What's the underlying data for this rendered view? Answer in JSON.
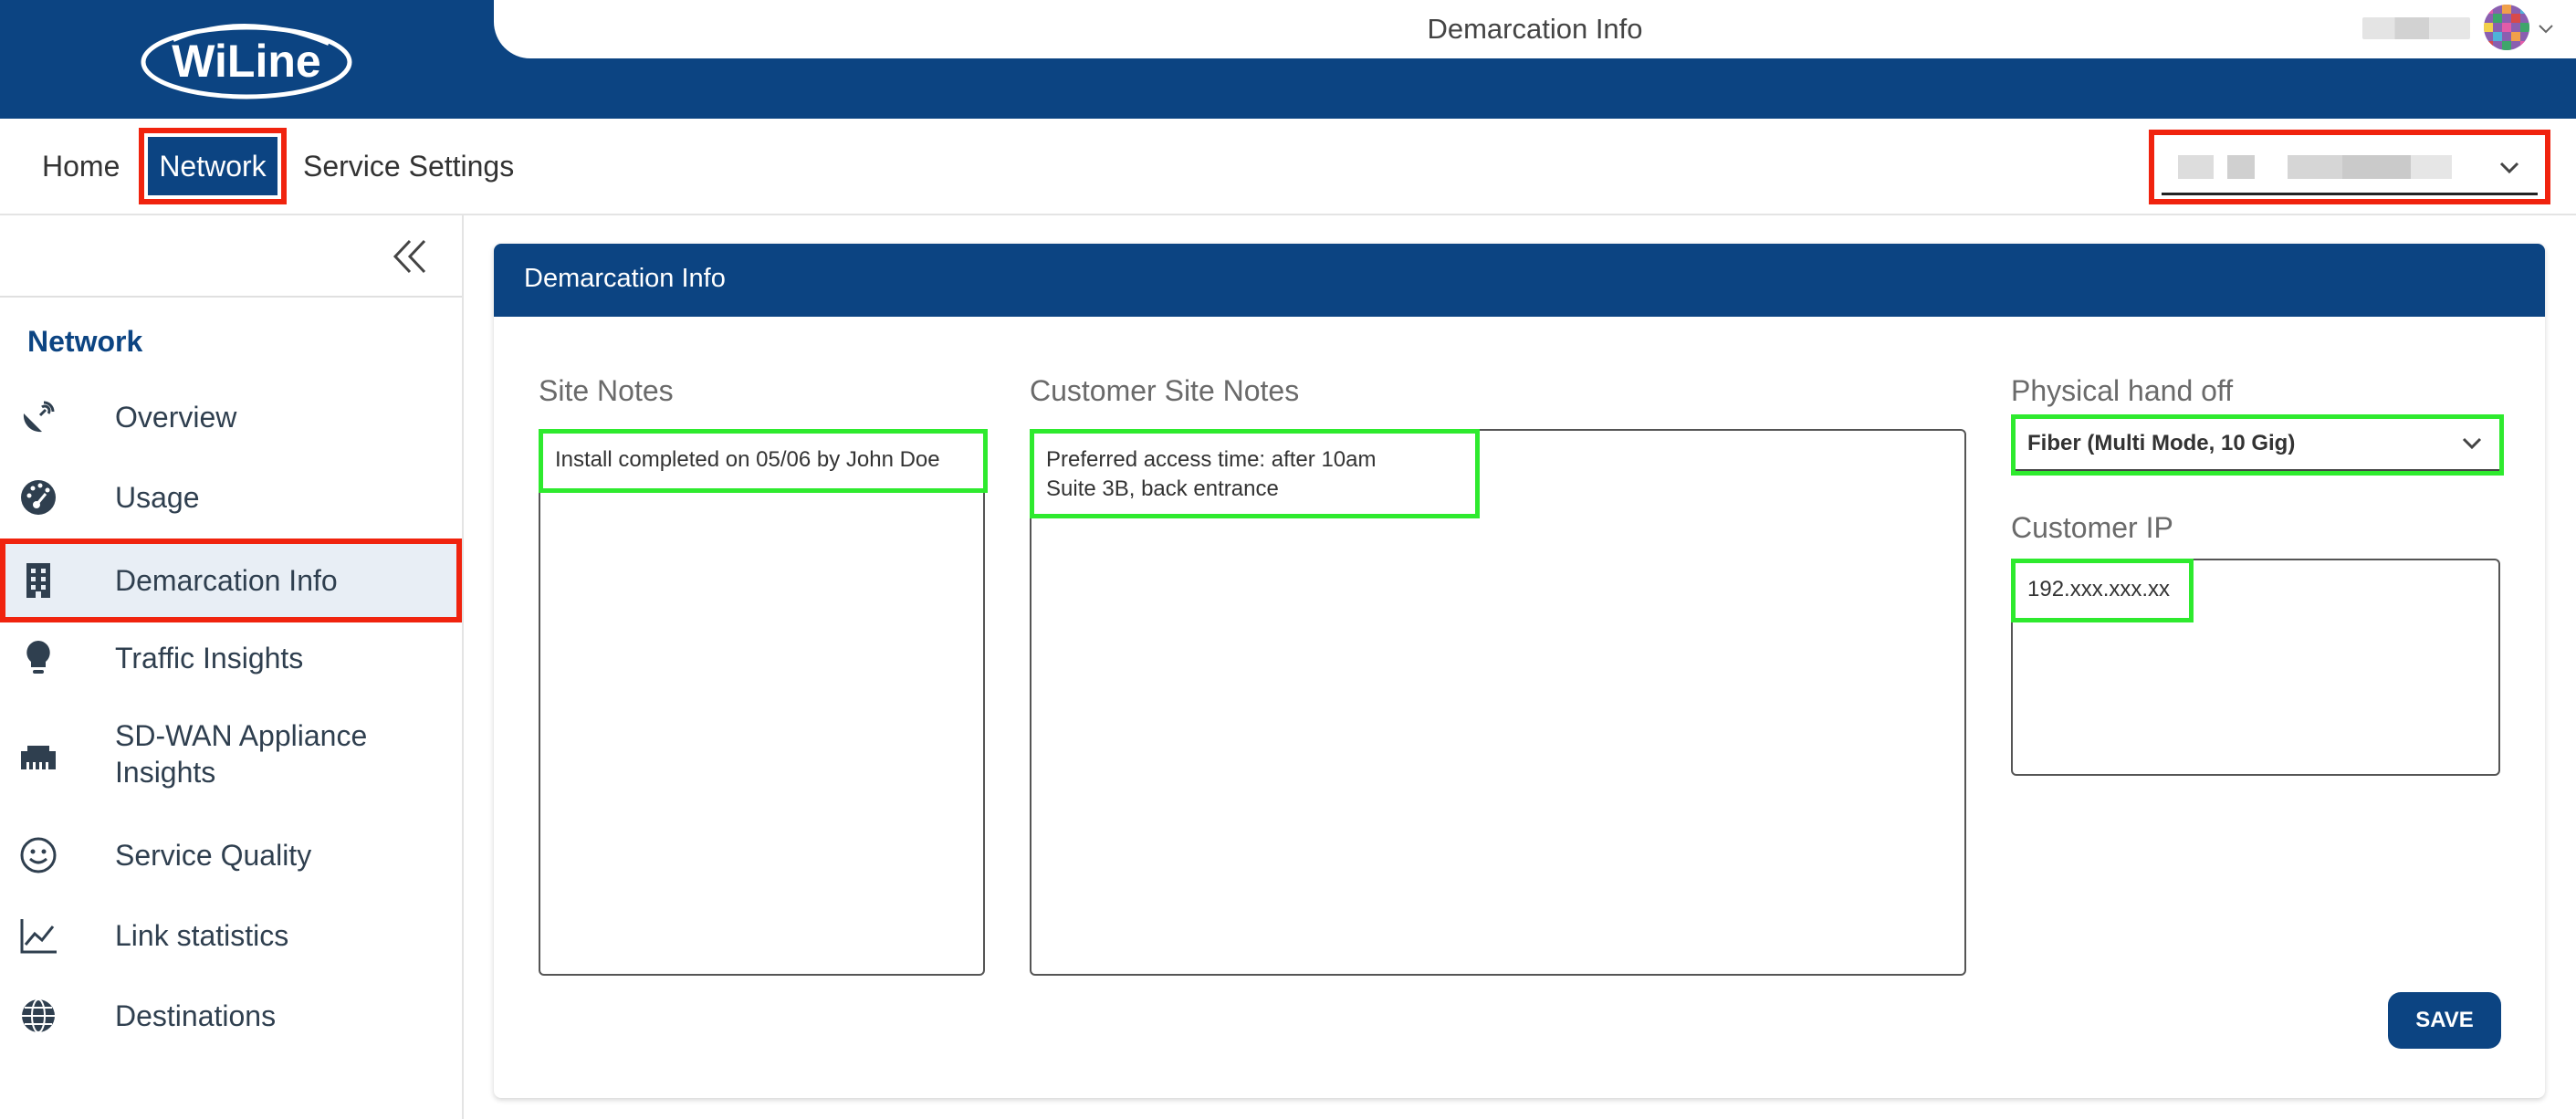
{
  "brand": {
    "logo_text": "WiLine",
    "primary_color": "#0c4482",
    "highlight_red": "#f0230e",
    "highlight_green": "#2eea2e"
  },
  "header": {
    "page_title": "Demarcation Info",
    "account_caret_icon": "chevron-down-icon"
  },
  "nav": {
    "items": [
      {
        "label": "Home"
      },
      {
        "label": "Network"
      },
      {
        "label": "Service Settings"
      }
    ],
    "active": "Network"
  },
  "sidebar": {
    "collapse_icon": "double-chevron-left-icon",
    "heading": "Network",
    "items": [
      {
        "label": "Overview",
        "icon": "satellite-dish-icon"
      },
      {
        "label": "Usage",
        "icon": "gauge-icon"
      },
      {
        "label": "Demarcation Info",
        "icon": "building-icon"
      },
      {
        "label": "Traffic Insights",
        "icon": "lightbulb-icon"
      },
      {
        "label": "SD-WAN Appliance Insights",
        "icon": "ethernet-port-icon"
      },
      {
        "label": "Service Quality",
        "icon": "smiley-icon"
      },
      {
        "label": "Link statistics",
        "icon": "line-chart-icon"
      },
      {
        "label": "Destinations",
        "icon": "globe-icon"
      }
    ],
    "active": "Demarcation Info"
  },
  "card": {
    "title": "Demarcation Info",
    "site_notes": {
      "label": "Site Notes",
      "value": "Install completed on 05/06 by John Doe"
    },
    "customer_site_notes": {
      "label": "Customer Site Notes",
      "value": "Preferred access time: after 10am\nSuite 3B, back entrance"
    },
    "physical_handoff": {
      "label": "Physical hand off",
      "value": "Fiber (Multi Mode, 10 Gig)"
    },
    "customer_ip": {
      "label": "Customer IP",
      "value": "192.xxx.xxx.xx"
    },
    "save_label": "SAVE"
  }
}
